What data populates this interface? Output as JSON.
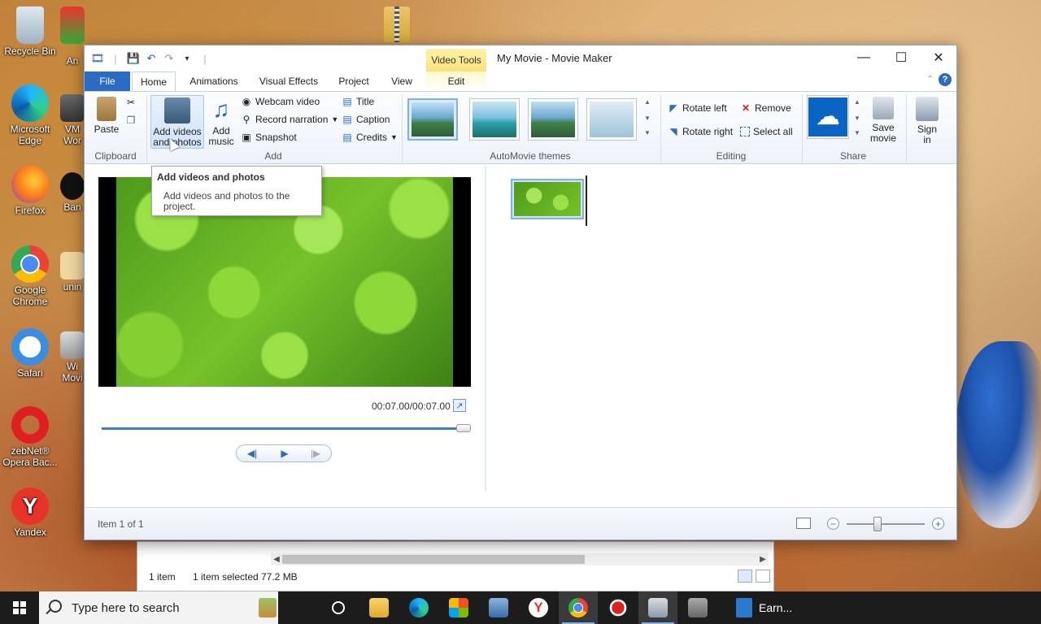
{
  "desktop": {
    "icons": [
      {
        "name": "Recycle Bin",
        "label": "Recycle Bin"
      },
      {
        "name": "Microsoft Edge",
        "label": "Microsoft Edge"
      },
      {
        "name": "Firefox",
        "label": "Firefox"
      },
      {
        "name": "Google Chrome",
        "label": "Google Chrome"
      },
      {
        "name": "Safari",
        "label": "Safari"
      },
      {
        "name": "zebNet Opera Backup",
        "label": "zebNet® Opera Bac..."
      },
      {
        "name": "Yandex",
        "label": "Yandex"
      },
      {
        "name": "An",
        "label": "An"
      },
      {
        "name": "VM Wor",
        "label": "VM Wor"
      },
      {
        "name": "Ban",
        "label": "Ban"
      },
      {
        "name": "unin",
        "label": "unin"
      },
      {
        "name": "Wi Movi",
        "label": "Wi Movi"
      }
    ]
  },
  "window": {
    "title": "My Movie - Movie Maker",
    "context_tab": "Video Tools",
    "tabs": [
      "File",
      "Home",
      "Animations",
      "Visual Effects",
      "Project",
      "View",
      "Edit"
    ],
    "help_label": "?"
  },
  "ribbon": {
    "clipboard": {
      "label": "Clipboard",
      "paste": "Paste"
    },
    "add": {
      "label": "Add",
      "add_videos_line1": "Add videos",
      "add_videos_line2": "and photos",
      "add_music_line1": "Add",
      "add_music_line2": "music",
      "webcam": "Webcam video",
      "narration": "Record narration",
      "snapshot": "Snapshot",
      "title": "Title",
      "caption": "Caption",
      "credits": "Credits"
    },
    "themes": {
      "label": "AutoMovie themes"
    },
    "editing": {
      "label": "Editing",
      "rotate_left": "Rotate left",
      "rotate_right": "Rotate right",
      "remove": "Remove",
      "select_all": "Select all"
    },
    "share": {
      "label": "Share",
      "save_line1": "Save",
      "save_line2": "movie",
      "sign_line1": "Sign",
      "sign_line2": "in"
    }
  },
  "tooltip": {
    "title": "Add videos and photos",
    "body": "Add videos and photos to the project."
  },
  "preview": {
    "time": "00:07.00/00:07.00",
    "progress": 1.0
  },
  "status": {
    "item_text": "Item 1 of 1",
    "zoom_level": 0.4
  },
  "explorer": {
    "items": "1 item",
    "selected": "1 item selected",
    "size": "77.2 MB"
  },
  "taskbar": {
    "search_placeholder": "Type here to search",
    "earn_label": "Earn..."
  }
}
